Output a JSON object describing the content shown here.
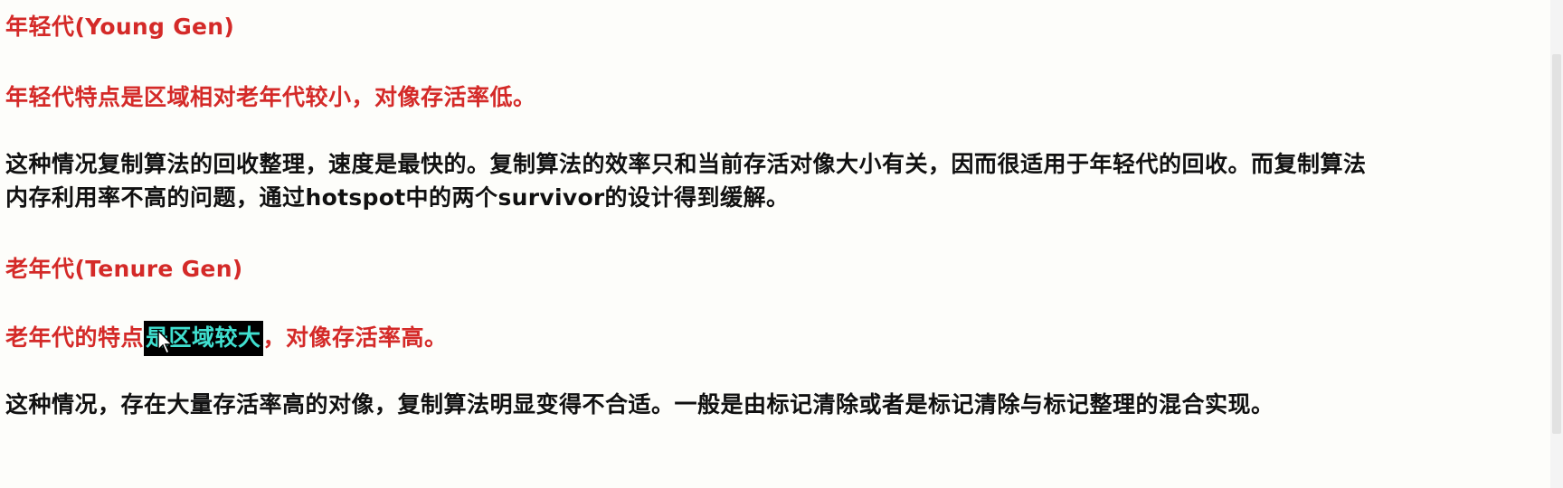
{
  "young": {
    "heading_cn": "年轻代",
    "heading_en": "(Young Gen)",
    "summary": "年轻代特点是区域相对老年代较小，对像存活率低。",
    "detail_line1": "这种情况复制算法的回收整理，速度是最快的。复制算法的效率只和当前存活对像大小有关，因而很适用于年轻代的回收。而复制算法",
    "detail_line2_a": "内存利用率不高的问题，通过",
    "detail_line2_b": "hotspot",
    "detail_line2_c": "中的两个",
    "detail_line2_d": "survivor",
    "detail_line2_e": "的设计得到缓解。"
  },
  "tenure": {
    "heading_cn": "老年代",
    "heading_en": "(Tenure Gen)",
    "summary_a": "老年代的特点",
    "summary_selected": "是区域较大",
    "summary_b": "，对像存活率高。",
    "detail": "这种情况，存在大量存活率高的对像，复制算法明显变得不合适。一般是由标记清除或者是标记清除与标记整理的混合实现。"
  },
  "colors": {
    "heading": "#d42a28",
    "body": "#111111",
    "selection_bg": "#000000",
    "selection_text": "#40e0d0",
    "page_bg": "#fdfdfa"
  },
  "icons": {
    "cursor": "mouse-pointer-icon"
  }
}
